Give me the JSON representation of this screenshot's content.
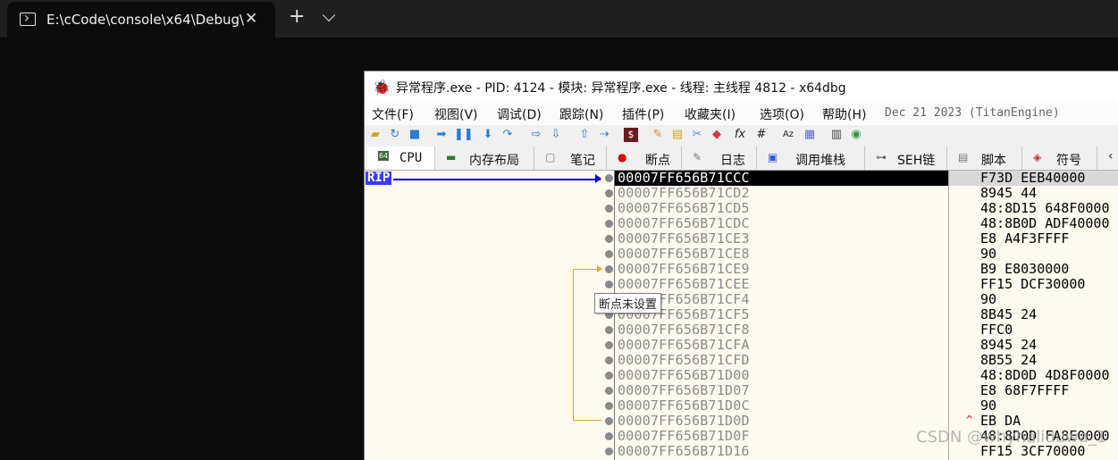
{
  "terminal": {
    "tab_title": "E:\\cCode\\console\\x64\\Debug\\",
    "close_glyph": "✕",
    "new_tab_glyph": "+"
  },
  "debugger": {
    "title": "异常程序.exe - PID: 4124 - 模块: 异常程序.exe - 线程: 主线程 4812 - x64dbg",
    "menu": [
      "文件(F)",
      "视图(V)",
      "调试(D)",
      "跟踪(N)",
      "插件(P)",
      "收藏夹(I)",
      "选项(O)",
      "帮助(H)"
    ],
    "engine_info": "Dec 21 2023 (TitanEngine)",
    "tabs": [
      {
        "label": "CPU",
        "icon": "cpu-icon",
        "active": true
      },
      {
        "label": "内存布局",
        "icon": "memory-icon"
      },
      {
        "label": "笔记",
        "icon": "notes-icon"
      },
      {
        "label": "断点",
        "icon": "breakpoint-icon"
      },
      {
        "label": "日志",
        "icon": "log-icon"
      },
      {
        "label": "调用堆栈",
        "icon": "callstack-icon"
      },
      {
        "label": "SEH链",
        "icon": "seh-icon"
      },
      {
        "label": "脚本",
        "icon": "script-icon"
      },
      {
        "label": "符号",
        "icon": "symbol-icon"
      }
    ],
    "rip_label": "RIP",
    "tooltip": "断点未设置",
    "rows": [
      {
        "addr": "00007FF656B71CCC",
        "bytes": "F73D EEB40000"
      },
      {
        "addr": "00007FF656B71CD2",
        "bytes": "8945 44"
      },
      {
        "addr": "00007FF656B71CD5",
        "bytes": "48:8D15 648F0000"
      },
      {
        "addr": "00007FF656B71CDC",
        "bytes": "48:8B0D ADF40000"
      },
      {
        "addr": "00007FF656B71CE3",
        "bytes": "E8 A4F3FFFF"
      },
      {
        "addr": "00007FF656B71CE8",
        "bytes": "90"
      },
      {
        "addr": "00007FF656B71CE9",
        "bytes": "B9 E8030000"
      },
      {
        "addr": "00007FF656B71CEE",
        "bytes": "FF15 DCF30000"
      },
      {
        "addr": "00007FF656B71CF4",
        "bytes": "90"
      },
      {
        "addr": "00007FF656B71CF5",
        "bytes": "8B45 24"
      },
      {
        "addr": "00007FF656B71CF8",
        "bytes": "FFC0"
      },
      {
        "addr": "00007FF656B71CFA",
        "bytes": "8945 24"
      },
      {
        "addr": "00007FF656B71CFD",
        "bytes": "8B55 24"
      },
      {
        "addr": "00007FF656B71D00",
        "bytes": "48:8D0D 4D8F0000"
      },
      {
        "addr": "00007FF656B71D07",
        "bytes": "E8 68F7FFFF"
      },
      {
        "addr": "00007FF656B71D0C",
        "bytes": "90"
      },
      {
        "addr": "00007FF656B71D0D",
        "bytes": "EB DA"
      },
      {
        "addr": "00007FF656B71D0F",
        "bytes": "48:8D0D FA8E0000"
      },
      {
        "addr": "00007FF656B71D16",
        "bytes": "FF15 3CF70000"
      }
    ],
    "jump_marker": "^"
  },
  "watermark": "CSDN @whyhaliduwa_1"
}
